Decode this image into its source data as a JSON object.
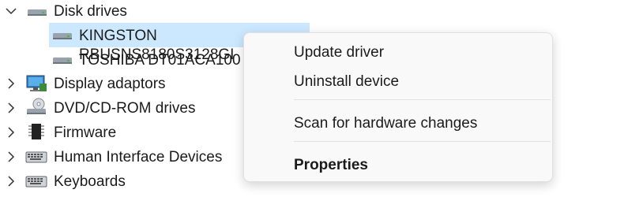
{
  "tree": {
    "items": [
      {
        "label": "Disk drives",
        "expanded": true,
        "icon": "disk-drive-icon"
      },
      {
        "label": "KINGSTON RBUSNS8180S3128GI",
        "icon": "drive-icon",
        "selected": true
      },
      {
        "label": "TOSHIBA DT01ACA100",
        "icon": "drive-icon"
      },
      {
        "label": "Display adaptors",
        "expanded": false,
        "icon": "display-adapter-icon"
      },
      {
        "label": "DVD/CD-ROM drives",
        "expanded": false,
        "icon": "dvd-drive-icon"
      },
      {
        "label": "Firmware",
        "expanded": false,
        "icon": "firmware-chip-icon"
      },
      {
        "label": "Human Interface Devices",
        "expanded": false,
        "icon": "hid-keyboard-icon"
      },
      {
        "label": "Keyboards",
        "expanded": false,
        "icon": "keyboard-icon"
      }
    ]
  },
  "context_menu": {
    "items": [
      {
        "label": "Update driver"
      },
      {
        "label": "Uninstall device"
      },
      {
        "label": "Scan for hardware changes"
      },
      {
        "label": "Properties",
        "bold": true
      }
    ]
  },
  "colors": {
    "selection": "#cce8ff",
    "menu_bg": "#f9f9f9"
  }
}
